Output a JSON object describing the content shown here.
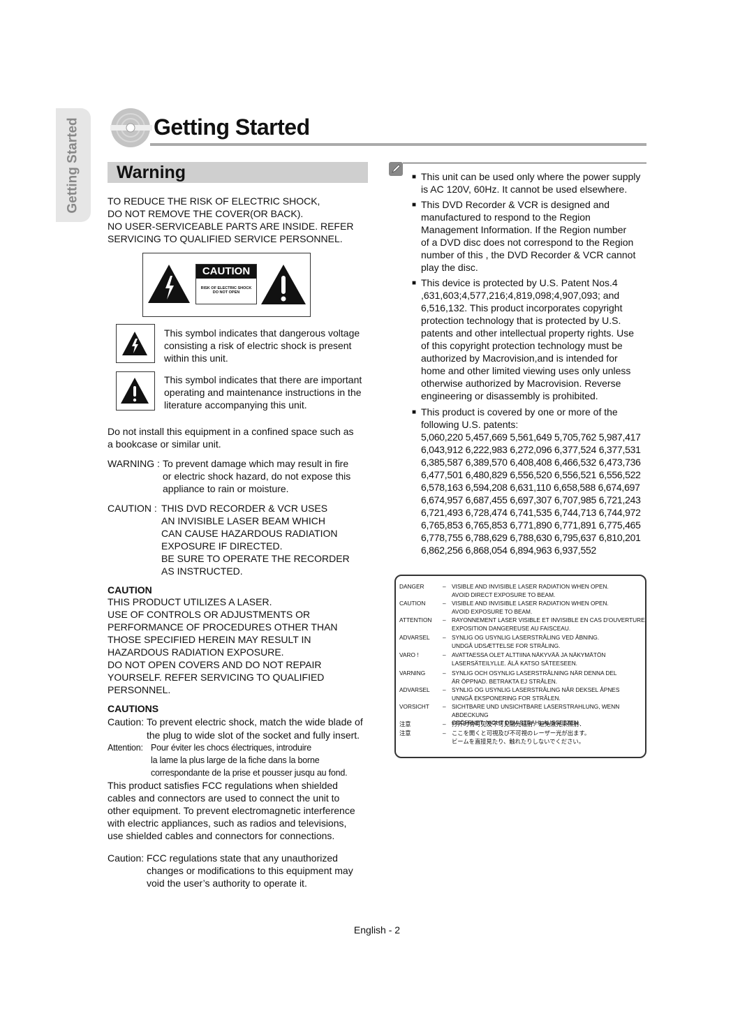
{
  "side_tab": "Getting Started",
  "title": "Getting Started",
  "warning_heading": "Warning",
  "left": {
    "intro": "TO REDUCE THE RISK OF ELECTRIC SHOCK,\nDO NOT REMOVE THE COVER(OR BACK).\nNO USER-SERVICEABLE PARTS ARE INSIDE. REFER\nSERVICING TO QUALIFIED SERVICE PERSONNEL.",
    "caution_label": {
      "title": "CAUTION",
      "line1": "RISK OF ELECTRIC SHOCK",
      "line2": "DO NOT OPEN"
    },
    "symbol1": "This symbol indicates that dangerous voltage\nconsisting a risk of electric shock is present\nwithin this unit.",
    "symbol2": "This symbol indicates that there are important\noperating and maintenance instructions in the\nliterature accompanying this unit.",
    "install": "Do not install this equipment in a confined space such as\na bookcase or similar unit.",
    "warning_label": "WARNING : ",
    "warning_text": "To prevent damage which may result in fire\nor electric shock hazard, do not expose this\nappliance to rain or moisture.",
    "caution_label2": "CAUTION : ",
    "caution_text": "THIS DVD RECORDER & VCR USES\nAN INVISIBLE LASER BEAM WHICH\nCAN CAUSE HAZARDOUS RADIATION\nEXPOSURE IF DIRECTED.\nBE SURE TO OPERATE THE RECORDER\nAS INSTRUCTED.",
    "caution_heading": "CAUTION",
    "caution_body": "THIS PRODUCT UTILIZES A LASER.\nUSE OF CONTROLS OR ADJUSTMENTS OR\nPERFORMANCE OF PROCEDURES OTHER THAN\nTHOSE SPECIFIED HEREIN MAY RESULT IN\nHAZARDOUS RADIATION EXPOSURE.\nDO NOT OPEN COVERS AND DO NOT REPAIR\nYOURSELF. REFER SERVICING TO QUALIFIED\nPERSONNEL.",
    "cautions_heading": "CAUTIONS",
    "plug_label": "Caution: ",
    "plug_text": "To prevent electric shock, match the wide blade of\nthe plug to wide slot of the socket and fully insert.",
    "attention_label": "Attention: ",
    "attention_text": "Pour éviter les chocs électriques, introduire\nla lame la plus large de la fiche dans la borne\ncorrespondante de la prise et pousser jusqu au fond.",
    "fcc": "This product satisfies FCC regulations when shielded\ncables and connectors are used to connect the unit to\nother equipment. To prevent electromagnetic interference\nwith electric appliances, such as radios and televisions,\nuse shielded cables and connectors for connections.",
    "fcc_caution_label": "Caution: ",
    "fcc_caution_text": "FCC regulations state that any unauthorized\nchanges or modifications to this equipment may\nvoid the user’s authority to operate it."
  },
  "right": {
    "bullets": [
      "This unit can be used only where the power supply\nis AC 120V, 60Hz. It cannot be used elsewhere.",
      "This DVD Recorder & VCR is designed and\nmanufactured to respond to the Region\nManagement Information. If the Region number\nof a DVD disc does not correspond to the Region\nnumber of this , the DVD Recorder & VCR cannot\nplay the disc.",
      "This device is protected by U.S. Patent Nos.4\n,631,603;4,577,216;4,819,098;4,907,093; and\n6,516,132. This product incorporates copyright\nprotection technology that is protected by U.S.\npatents and other intellectual property rights. Use\nof this copyright protection technology must be\nauthorized by Macrovision,and is intended for\nhome and other limited viewing uses only unless\notherwise authorized by Macrovision. Reverse\nengineering or disassembly is prohibited.",
      "This product is covered by one or more of the\nfollowing U.S. patents:"
    ],
    "patents": "5,060,220 5,457,669 5,561,649 5,705,762 5,987,417\n6,043,912 6,222,983 6,272,096 6,377,524 6,377,531\n6,385,587 6,389,570 6,408,408 6,466,532 6,473,736\n6,477,501 6,480,829 6,556,520 6,556,521 6,556,522\n6,578,163 6,594,208 6,631,110 6,658,588 6,674,697\n6,674,957 6,687,455 6,697,307 6,707,985 6,721,243\n6,721,493 6,728,474 6,741,535 6,744,713 6,744,972\n6,765,853 6,765,853 6,771,890 6,771,891 6,775,465\n6,778,755 6,788,629 6,788,630 6,795,637 6,810,201\n6,862,256 6,868,054 6,894,963 6,937,552"
  },
  "laser_label": [
    {
      "label": "DANGER",
      "dash": "–",
      "text": "VISIBLE AND INVISIBLE LASER RADIATION WHEN OPEN.\nAVOID DIRECT EXPOSURE TO BEAM."
    },
    {
      "label": "CAUTION",
      "dash": "–",
      "text": "VISIBLE AND INVISIBLE LASER RADIATION WHEN OPEN.\nAVOID EXPOSURE TO BEAM."
    },
    {
      "label": "ATTENTION",
      "dash": "–",
      "text": "RAYONNEMENT LASER VISIBLE ET INVISIBLE EN CAS D'OUVERTURE.\nEXPOSITION DANGEREUSE AU FAISCEAU."
    },
    {
      "label": "ADVARSEL",
      "dash": "–",
      "text": "SYNLIG OG USYNLIG LASERSTRÅLING VED ÅBNING.\nUNDGÅ UDSÆTTELSE FOR STRÅLING."
    },
    {
      "label": "VARO !",
      "dash": "–",
      "text": "AVATTAESSA OLET ALTTIINA NÄKYVÄÄ JA NÄKYMÄTÖN\nLASERSÄTEILYLLE. ÄLÄ KATSO SÄTEESEEN."
    },
    {
      "label": "VARNING",
      "dash": "–",
      "text": "SYNLIG OCH OSYNLIG LASERSTRÅLNING NÄR DENNA DEL\nÄR ÖPPNAD. BETRAKTA EJ STRÅLEN."
    },
    {
      "label": "ADVARSEL",
      "dash": "–",
      "text": "SYNLIG OG USYNLIG LASERSTRÅLING NÅR DEKSEL ÅPNES\nUNNGÅ EKSPONERING FOR STRÅLEN."
    },
    {
      "label": "VORSICHT",
      "dash": "–",
      "text": "SICHTBARE UND UNSICHTBARE LASERSTRAHLUNG, WENN ABDECKUNG\nGEÖFFNET. NICHT DEM STRAHL AUSSETZEN."
    },
    {
      "label": "注意",
      "dash": "–",
      "text": "打开时有可见及不可见激光辐射．避免激光束照射．"
    },
    {
      "label": "注意",
      "dash": "–",
      "text": "ここを開くと可視及び不可視のレーザー光が出ます。\nビームを直接見たり、触れたりしないでください。"
    }
  ],
  "footer": "English - 2"
}
